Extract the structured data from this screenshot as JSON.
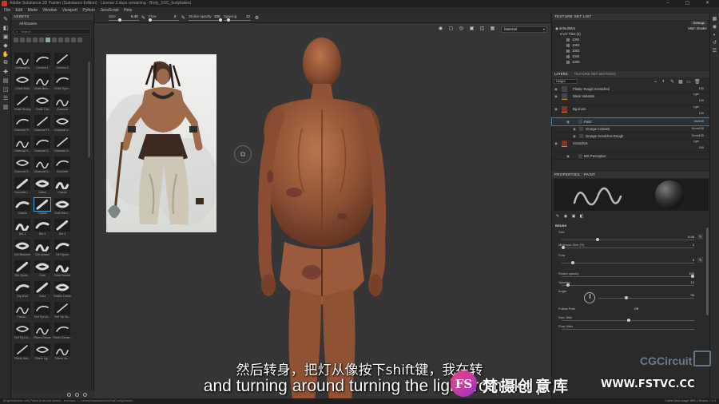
{
  "window": {
    "title": "Adobe Substance 3D Painter (Substance Edition) - License 3 days remaining - Body_SSC_bodybaked"
  },
  "menu": [
    "File",
    "Edit",
    "Mode",
    "Window",
    "Viewport",
    "Python",
    "JavaScript",
    "Help"
  ],
  "toolbar": {
    "size_label": "Size",
    "size_value": "8.46",
    "flow_label": "Flow",
    "flow_value": "8",
    "stroke_opacity_label": "Stroke opacity",
    "stroke_opacity_value": "100",
    "spacing_label": "Spacing",
    "spacing_value": "12"
  },
  "assets": {
    "panel_title": "ASSETS",
    "library": "All libraries",
    "search_placeholder": "Search",
    "items": [
      "Calligraphic",
      "Cement 1",
      "Cement 2",
      "Chalk Bold",
      "Chalk Bum...",
      "Chalk Spre...",
      "Chalk Strong",
      "Chalk Thin",
      "Charcoal",
      "Charcoal Fi...",
      "Charcoal Fi...",
      "Charcoal U...",
      "Charcoal O...",
      "Charcoal O...",
      "Charcoal O...",
      "Charcoal S...",
      "Charcoal S...",
      "Concrete",
      "Concrete L...",
      "Cotton",
      "Cracks",
      "Cracks",
      "Crystal",
      "Dust Hard...",
      "Dirt 1",
      "Dirt 2",
      "Dirt 3",
      "Dirt Brushed",
      "Dirt Splash",
      "Dirt Spots",
      "Dirt Spots...",
      "Dots",
      "Dots Erased",
      "Dry Mud",
      "Dust",
      "Elastic Linear",
      "Fabric...",
      "Felt Tip Lin...",
      "Felt Tip Va...",
      "Felt Tip Lin...",
      "Fibers Dense",
      "Fibers Dense...",
      "Fibers Hair...",
      "Fibers Lig...",
      "Fibers Lin..."
    ]
  },
  "viewport": {
    "mode_dropdown": "Material"
  },
  "texture_set_list": {
    "title": "TEXTURE SET LIST",
    "settings_button": "Settings",
    "set_name": "defaultMat",
    "shader": "Main shader",
    "uv_tiles_label": "UV Tiles (6)",
    "tiles": [
      "1001",
      "1002",
      "1003",
      "1004",
      "1005"
    ]
  },
  "layers": {
    "tab_layers": "LAYERS",
    "tab_settings": "TEXTURE SET SETTINGS",
    "channel": "Height",
    "items": [
      {
        "name": "Plastic Rough Scratched",
        "blend": "",
        "opacity": "100"
      },
      {
        "name": "Wear Variation",
        "blend": "Lgte",
        "opacity": "100"
      },
      {
        "name": "Bg scars",
        "blend": "Lgte",
        "opacity": "100"
      },
      {
        "name": "Paint",
        "blend": "Mul",
        "opacity": "100"
      },
      {
        "name": "Grunge Cobweb",
        "blend": "Norm",
        "opacity": "100"
      },
      {
        "name": "Grunge Scratches Rough",
        "blend": "Norm",
        "opacity": "100"
      },
      {
        "name": "Scratches",
        "blend": "Lgte",
        "opacity": "100"
      },
      {
        "name": "MG Perceptive",
        "blend": "",
        "opacity": ""
      }
    ]
  },
  "properties": {
    "title": "PROPERTIES - PAINT",
    "brush_section": "BRUSH",
    "size_label": "Size",
    "size_value": "8.46",
    "min_size_label": "Minimum Size (%)",
    "min_size_value": "0",
    "flow_label": "Flow",
    "flow_value": "8",
    "stroke_opacity_label": "Stroke opacity",
    "stroke_opacity_value": "100",
    "spacing_label": "Spacing",
    "spacing_value": "12",
    "angle_label": "Angle",
    "angle_value": "90",
    "follow_path_label": "Follow Path",
    "follow_path_value": "Off",
    "size_jitter_label": "Size Jitter",
    "flow_jitter_label": "Flow Jitter"
  },
  "statusbar": {
    "left": "[Engine/Modern-cell] Failed to decode texture - resource: /.../ Library/SubstanceInfo/FullConfig/Cache/...",
    "right": "Cache Disk Usage: 88% | Version: 7.4.3"
  },
  "subtitles": {
    "chinese": "然后转身，把灯从像按下shift键，我在转",
    "english": "and turning around turning the light from like pr"
  },
  "watermark": {
    "logo_letters": "FS",
    "name": "梵摄创意库",
    "url": "WWW.FSTVC.CC",
    "corner": "CGCircuit"
  }
}
